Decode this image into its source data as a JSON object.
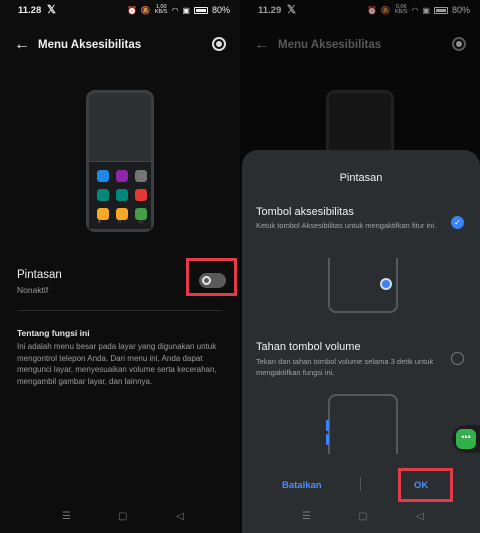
{
  "left": {
    "status": {
      "time": "11.28",
      "battery": "80%",
      "net_speed_top": "1,00",
      "net_speed_bottom": "KB/S"
    },
    "appbar": {
      "title": "Menu Aksesibilitas"
    },
    "item": {
      "title": "Pintasan",
      "subtitle": "Nonaktif"
    },
    "about": {
      "title": "Tentang fungsi ini",
      "body": "Ini adalah menu besar pada layar yang digunakan untuk mengontrol telepon Anda. Dari menu ini, Anda dapat mengunci layar, menyesuaikan volume serta kecerahan, mengambil gambar layar, dan lainnya."
    },
    "icon_colors": [
      "#1e88e5",
      "#8e24aa",
      "#757575",
      "#00897b",
      "#00897b",
      "#e53935",
      "#f9a825",
      "#f9a825",
      "#43a047"
    ]
  },
  "right": {
    "status": {
      "time": "11.29",
      "battery": "80%",
      "net_speed_top": "0,06",
      "net_speed_bottom": "KB/S"
    },
    "appbar": {
      "title": "Menu Aksesibilitas"
    },
    "sheet": {
      "title": "Pintasan",
      "option1": {
        "title": "Tombol aksesibilitas",
        "desc": "Ketuk tombol Aksesibilitas untuk mengaktifkan fitur ini.",
        "selected": true
      },
      "option2": {
        "title": "Tahan tombol volume",
        "desc": "Tekan dan tahan tombol volume selama 3 detik untuk mengaktifkan fungsi ini.",
        "selected": false
      },
      "cancel": "Batalkan",
      "ok": "OK"
    }
  },
  "navbar": {
    "menu_icon": "menu-icon",
    "home_icon": "home-icon",
    "back_icon": "back-icon"
  },
  "colors": {
    "accent": "#4f8df5",
    "highlight": "#e33b4b",
    "background": "#0d0d0d",
    "sheet": "#2b2e31"
  }
}
